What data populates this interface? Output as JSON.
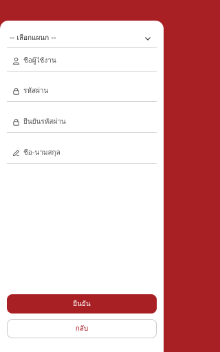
{
  "form": {
    "plan_select": {
      "value": "-- เลือกแผนก --",
      "icon": "chevron-down-icon"
    },
    "username": {
      "placeholder": "ชื่อผู้ใช้งาน",
      "icon": "user-icon"
    },
    "password": {
      "placeholder": "รหัสผ่าน",
      "icon": "lock-icon"
    },
    "confirm_password": {
      "placeholder": "ยืนยันรหัสผ่าน",
      "icon": "lock-icon"
    },
    "fullname": {
      "placeholder": "ชื่อ-นามสกุล",
      "icon": "pencil-icon"
    }
  },
  "actions": {
    "confirm_label": "ยืนยัน",
    "back_label": "กลับ"
  },
  "colors": {
    "brand": "#a81f24",
    "surface": "#ffffff",
    "divider": "#cfcfcf"
  }
}
